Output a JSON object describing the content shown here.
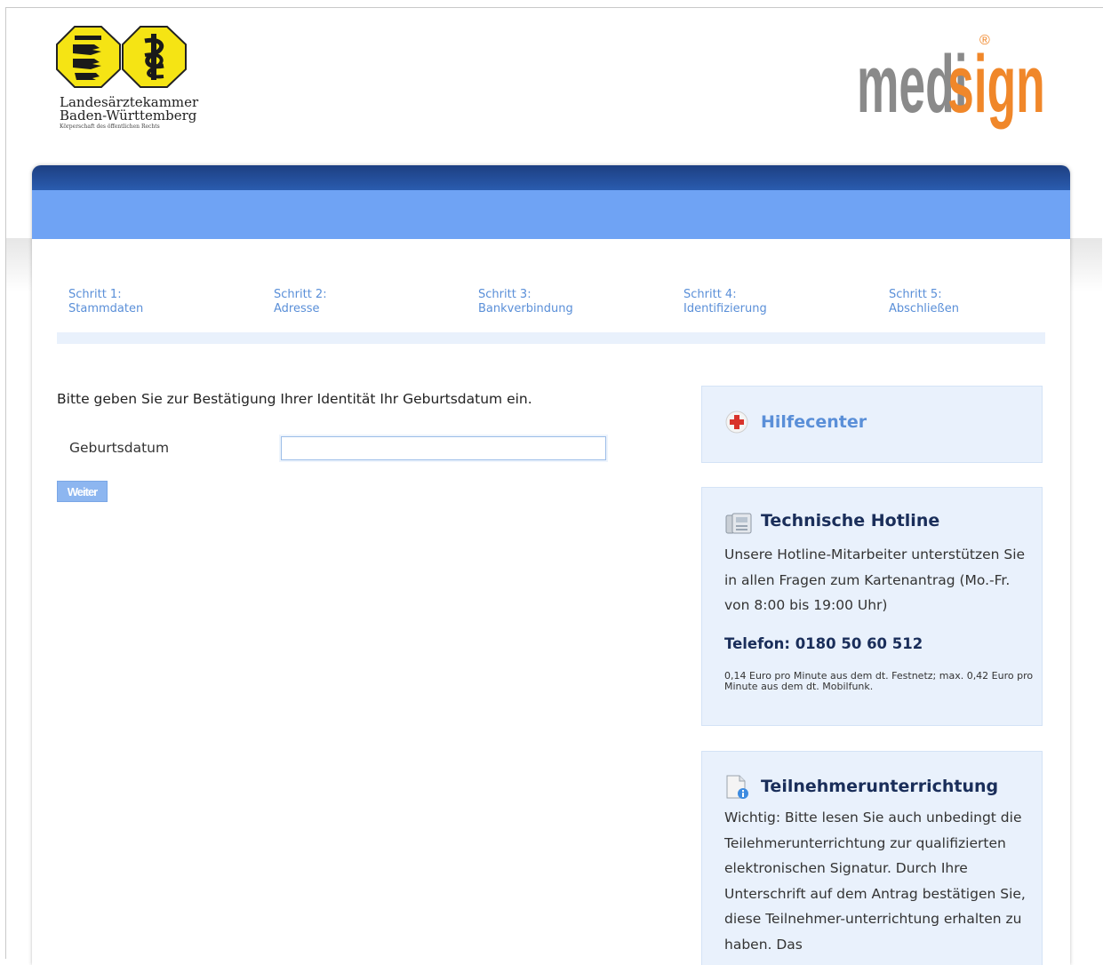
{
  "header": {
    "chamber_line1": "Landesärztekammer",
    "chamber_line2": "Baden-Württemberg",
    "chamber_line3": "Körperschaft des öffentlichen Rechts",
    "brand_grey": "medi",
    "brand_orange": "sign",
    "brand_registered": "®",
    "colors": {
      "brand_grey": "#8a8a8a",
      "brand_orange": "#f0872a",
      "emblem_yellow": "#f5e414"
    }
  },
  "steps": [
    {
      "title": "Schritt 1:",
      "name": "Stammdaten"
    },
    {
      "title": "Schritt 2:",
      "name": "Adresse"
    },
    {
      "title": "Schritt 3:",
      "name": "Bankverbindung"
    },
    {
      "title": "Schritt 4:",
      "name": "Identifizierung"
    },
    {
      "title": "Schritt 5:",
      "name": "Abschließen"
    }
  ],
  "form": {
    "instruction": "Bitte geben Sie zur Bestätigung Ihrer Identität Ihr Geburtsdatum ein.",
    "birthdate_label": "Geburtsdatum",
    "birthdate_value": "",
    "submit_label": "Weiter"
  },
  "sidebar": {
    "help_title": "Hilfecenter",
    "hotline": {
      "title": "Technische Hotline",
      "text": "Unsere Hotline-Mitarbeiter unterstützen Sie in allen Fragen zum Kartenantrag (Mo.-Fr. von 8:00 bis 19:00 Uhr)",
      "phone": "Telefon: 0180 50 60 512",
      "fine_print": "0,14 Euro pro Minute aus dem dt. Festnetz; max. 0,42 Euro pro Minute aus dem dt. Mobilfunk."
    },
    "info": {
      "title": "Teilnehmerunterrichtung",
      "text": "Wichtig: Bitte lesen Sie auch unbedingt die Teilehmerunterrichtung zur qualifizierten elektronischen Signatur. Durch Ihre Unterschrift auf dem Antrag bestätigen Sie, diese Teilnehmer-unterrichtung erhalten zu haben. Das"
    }
  },
  "icons": {
    "help": "red-cross-icon",
    "hotline": "phone-icon",
    "info": "document-info-icon"
  }
}
